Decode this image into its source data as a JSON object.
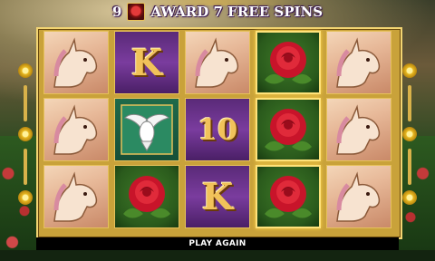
{
  "banner": {
    "count": "9",
    "scatter_icon": "rose-icon",
    "text": "AWARD 7 FREE SPINS"
  },
  "reels": [
    {
      "symbols": [
        "unicorn",
        "unicorn",
        "unicorn"
      ]
    },
    {
      "symbols": [
        "K",
        "dove",
        "rose"
      ]
    },
    {
      "symbols": [
        "unicorn",
        "10",
        "K"
      ]
    },
    {
      "symbols": [
        "rose",
        "rose",
        "rose"
      ]
    },
    {
      "symbols": [
        "unicorn",
        "unicorn",
        "unicorn"
      ]
    }
  ],
  "labels": {
    "k": "K",
    "ten": "10"
  },
  "controls": {
    "play_again": "PLAY AGAIN"
  },
  "colors": {
    "frame_gold": "#c9a23a",
    "royal_purple": "#5a2a78",
    "rose_red": "#c8142a"
  }
}
